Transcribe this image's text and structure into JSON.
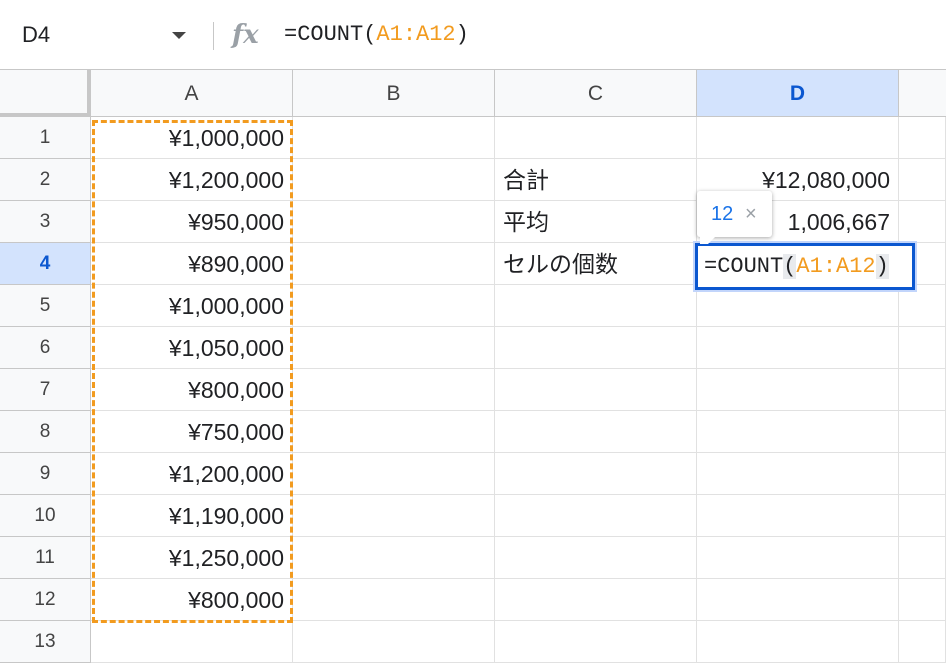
{
  "formula_bar": {
    "name_box": "D4",
    "fx_label": "fx",
    "formula_prefix": "=COUNT(",
    "formula_ref": "A1:A12",
    "formula_suffix": ")"
  },
  "columns": [
    "A",
    "B",
    "C",
    "D"
  ],
  "active_column": "D",
  "rows": [
    "1",
    "2",
    "3",
    "4",
    "5",
    "6",
    "7",
    "8",
    "9",
    "10",
    "11",
    "12",
    "13"
  ],
  "active_row": "4",
  "column_a_values": [
    "¥1,000,000",
    "¥1,200,000",
    "¥950,000",
    "¥890,000",
    "¥1,000,000",
    "¥1,050,000",
    "¥800,000",
    "¥750,000",
    "¥1,200,000",
    "¥1,190,000",
    "¥1,250,000",
    "¥800,000"
  ],
  "labels": {
    "total": "合計",
    "average": "平均",
    "count": "セルの個数"
  },
  "values": {
    "total": "¥12,080,000",
    "average": "1,006,667"
  },
  "editor": {
    "prefix": "=COUNT",
    "open_paren": "(",
    "ref": "A1:A12",
    "close_paren": ")"
  },
  "result_tooltip": {
    "value": "12",
    "close": "×"
  },
  "colors": {
    "accent": "#0b57d0",
    "reference": "#f29b1f",
    "header_active_bg": "#d3e3fd"
  }
}
